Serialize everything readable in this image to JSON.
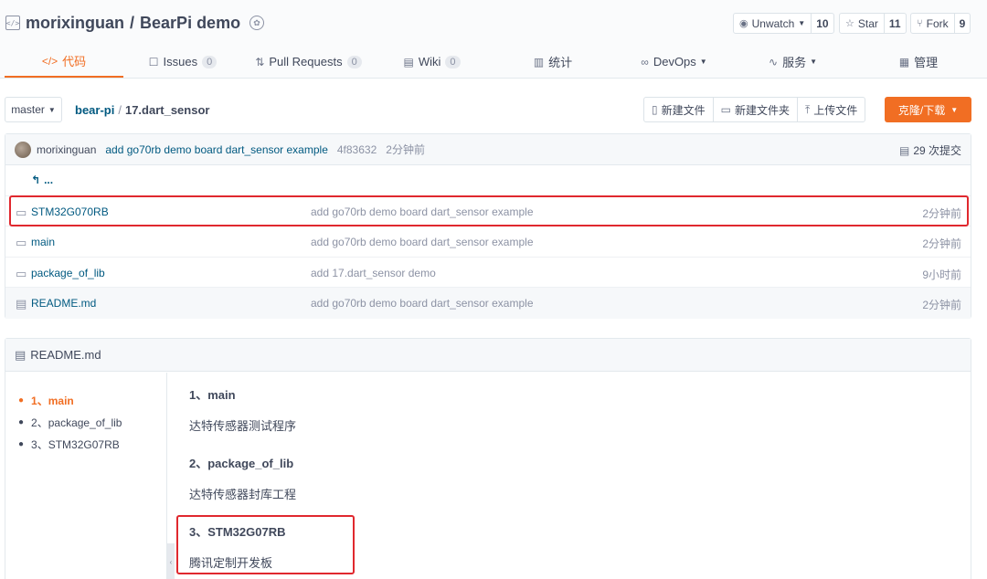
{
  "repo": {
    "owner": "morixinguan",
    "separator": "/",
    "name": "BearPi demo",
    "repo_icon": "code-icon",
    "badge_icon": "recommend-badge-icon"
  },
  "social": {
    "watch": {
      "label": "Unwatch",
      "count": "10",
      "icon": "eye-icon"
    },
    "star": {
      "label": "Star",
      "count": "11",
      "icon": "star-icon"
    },
    "fork": {
      "label": "Fork",
      "count": "9",
      "icon": "fork-icon"
    }
  },
  "nav": {
    "code": {
      "label": "代码",
      "icon": "code-icon"
    },
    "issues": {
      "label": "Issues",
      "count": "0",
      "icon": "issues-icon"
    },
    "pulls": {
      "label": "Pull Requests",
      "count": "0",
      "icon": "pull-request-icon"
    },
    "wiki": {
      "label": "Wiki",
      "count": "0",
      "icon": "wiki-icon"
    },
    "stats": {
      "label": "统计",
      "icon": "bar-chart-icon"
    },
    "devops": {
      "label": "DevOps",
      "icon": "infinity-icon"
    },
    "services": {
      "label": "服务",
      "icon": "pulse-icon"
    },
    "manage": {
      "label": "管理",
      "icon": "settings-doc-icon"
    }
  },
  "toolbar": {
    "branch": "master",
    "breadcrumb_root": "bear-pi",
    "breadcrumb_sep": "/",
    "breadcrumb_current": "17.dart_sensor",
    "new_file": "新建文件",
    "new_folder": "新建文件夹",
    "upload": "上传文件",
    "clone": "克隆/下载"
  },
  "commit": {
    "author": "morixinguan",
    "message": "add go70rb demo board dart_sensor example",
    "hash": "4f83632",
    "time": "2分钟前",
    "count": "29 次提交"
  },
  "files": {
    "back": "...",
    "rows": [
      {
        "name": "STM32G070RB",
        "message": "add go70rb demo board dart_sensor example",
        "time": "2分钟前",
        "icon": "folder-icon"
      },
      {
        "name": "main",
        "message": "add go70rb demo board dart_sensor example",
        "time": "2分钟前",
        "icon": "folder-icon"
      },
      {
        "name": "package_of_lib",
        "message": "add 17.dart_sensor demo",
        "time": "9小时前",
        "icon": "folder-icon"
      },
      {
        "name": "README.md",
        "message": "add go70rb demo board dart_sensor example",
        "time": "2分钟前",
        "icon": "file-icon"
      }
    ]
  },
  "readme": {
    "title": "README.md",
    "toc": [
      "1、main",
      "2、package_of_lib",
      "3、STM32G07RB"
    ],
    "sections": [
      {
        "heading": "1、main",
        "text": "达特传感器测试程序"
      },
      {
        "heading": "2、package_of_lib",
        "text": "达特传感器封库工程"
      },
      {
        "heading": "3、STM32G07RB",
        "text": "腾讯定制开发板"
      }
    ]
  },
  "colors": {
    "accent": "#f16e23",
    "link": "#005980",
    "highlight": "#e0282e"
  }
}
